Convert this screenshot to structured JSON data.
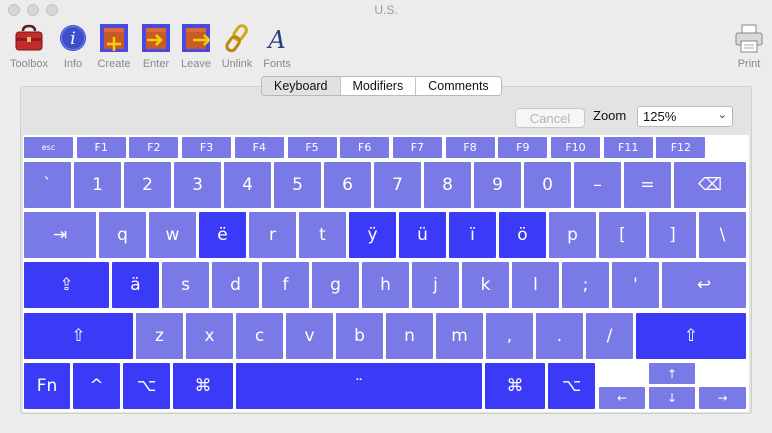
{
  "window": {
    "title": "U.S."
  },
  "toolbar": {
    "items": [
      {
        "label": "Toolbox",
        "icon": "toolbox-icon"
      },
      {
        "label": "Info",
        "icon": "info-icon"
      },
      {
        "label": "Create",
        "icon": "create-dead-key-icon"
      },
      {
        "label": "Enter",
        "icon": "enter-dead-key-icon"
      },
      {
        "label": "Leave",
        "icon": "leave-dead-key-icon"
      },
      {
        "label": "Unlink",
        "icon": "unlink-icon"
      },
      {
        "label": "Fonts",
        "icon": "fonts-icon"
      },
      {
        "label": "Print",
        "icon": "printer-icon"
      }
    ]
  },
  "tabs": {
    "keyboard": "Keyboard",
    "modifiers": "Modifiers",
    "comments": "Comments",
    "active": "Keyboard"
  },
  "controls": {
    "cancel_label": "Cancel",
    "zoom_label": "Zoom",
    "zoom_value": "125%"
  },
  "colors": {
    "key_normal": "#7a7ae6",
    "key_highlight": "#3b3bf7"
  },
  "keyboard": {
    "fn_row": [
      "esc",
      "F1",
      "F2",
      "F3",
      "F4",
      "F5",
      "F6",
      "F7",
      "F8",
      "F9",
      "F10",
      "F11",
      "F12"
    ],
    "number_row": [
      "`",
      "1",
      "2",
      "3",
      "4",
      "5",
      "6",
      "7",
      "8",
      "9",
      "0",
      "–",
      "=",
      "⌫"
    ],
    "top_row": [
      "⇥",
      "q",
      "w",
      "ë",
      "r",
      "t",
      "ÿ",
      "ü",
      "ï",
      "ö",
      "p",
      "[",
      "]",
      "\\"
    ],
    "home_row": [
      "⇪",
      "ä",
      "s",
      "d",
      "f",
      "g",
      "h",
      "j",
      "k",
      "l",
      ";",
      "'",
      "↩"
    ],
    "bottom_row": [
      "⇧",
      "z",
      "x",
      "c",
      "v",
      "b",
      "n",
      "m",
      ",",
      ".",
      "/",
      "⇧"
    ],
    "space_row": [
      "Fn",
      "^",
      "⌥",
      "⌘",
      "¨",
      "⌘",
      "⌥"
    ],
    "arrows": [
      "↑",
      "←",
      "↓",
      "→"
    ],
    "highlighted": [
      "ë",
      "ÿ",
      "ü",
      "ï",
      "ö",
      "ä",
      "⇪",
      "⇧",
      "Fn",
      "^",
      "⌥",
      "⌘",
      "¨"
    ]
  }
}
